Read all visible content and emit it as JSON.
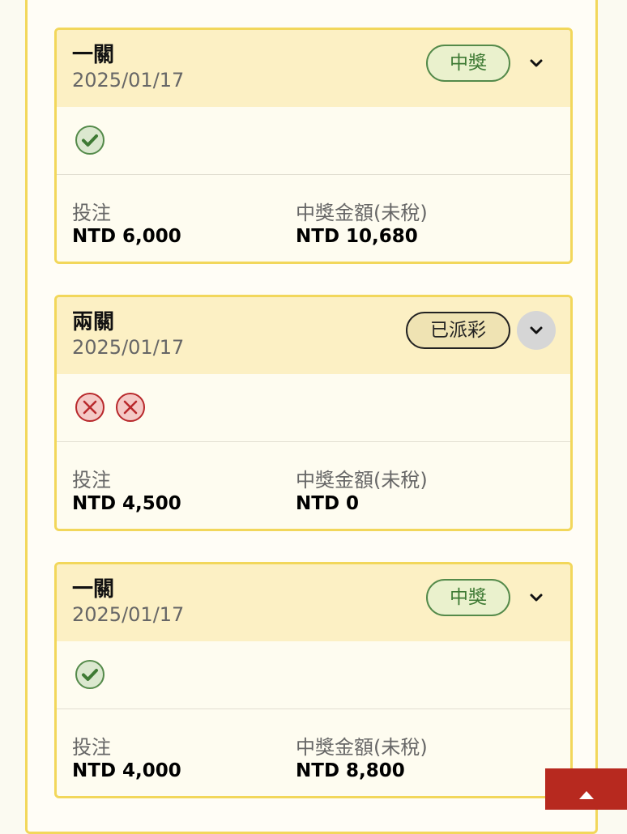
{
  "bets": [
    {
      "title": "一關",
      "date": "2025/01/17",
      "status": "中獎",
      "status_type": "won",
      "results": [
        "win"
      ],
      "stake_label": "投注",
      "stake_value": "NTD 6,000",
      "prize_label": "中獎金額(未稅)",
      "prize_value": "NTD 10,680"
    },
    {
      "title": "兩關",
      "date": "2025/01/17",
      "status": "已派彩",
      "status_type": "paid",
      "results": [
        "loss",
        "loss"
      ],
      "stake_label": "投注",
      "stake_value": "NTD 4,500",
      "prize_label": "中獎金額(未稅)",
      "prize_value": "NTD 0"
    },
    {
      "title": "一關",
      "date": "2025/01/17",
      "status": "中獎",
      "status_type": "won",
      "results": [
        "win"
      ],
      "stake_label": "投注",
      "stake_value": "NTD 4,000",
      "prize_label": "中獎金額(未稅)",
      "prize_value": "NTD 8,800"
    }
  ],
  "colors": {
    "card_border": "#f2d75b",
    "header_bg": "#fcf0c4",
    "won_green": "#3e7a34",
    "loss_red": "#b8282b",
    "back_to_top_bg": "#b7291f"
  },
  "icons": {
    "win": "check-circle-icon",
    "loss": "x-circle-icon",
    "expand": "chevron-down-icon",
    "back_to_top": "arrow-up-icon"
  }
}
